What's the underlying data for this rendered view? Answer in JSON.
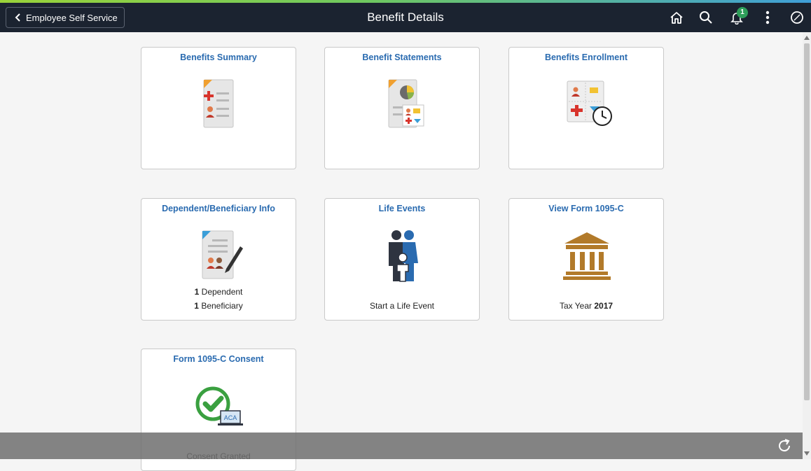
{
  "banner": {
    "back_label": "Employee Self Service",
    "title": "Benefit Details",
    "notification_count": "1"
  },
  "colors": {
    "banner_bg": "#1b2330",
    "tile_title": "#2a6bb0",
    "consent_green": "#3aa040",
    "form_gold": "#b27a2a"
  },
  "tiles": [
    {
      "title": "Benefits Summary",
      "icon": "benefits-summary-icon"
    },
    {
      "title": "Benefit Statements",
      "icon": "benefit-statements-icon"
    },
    {
      "title": "Benefits Enrollment",
      "icon": "benefits-enrollment-icon"
    },
    {
      "title": "Dependent/Beneficiary Info",
      "icon": "dependent-info-icon",
      "line1_count": "1",
      "line1_text": "Dependent",
      "line2_count": "1",
      "line2_text": "Beneficiary"
    },
    {
      "title": "Life Events",
      "icon": "family-icon",
      "line1_text": "Start a Life Event"
    },
    {
      "title": "View Form 1095-C",
      "icon": "government-building-icon",
      "line1_text": "Tax Year",
      "line1_value": "2017"
    },
    {
      "title": "Form 1095-C Consent",
      "icon": "consent-check-icon",
      "badge_text": "ACA",
      "line1_text": "Consent Granted"
    }
  ]
}
